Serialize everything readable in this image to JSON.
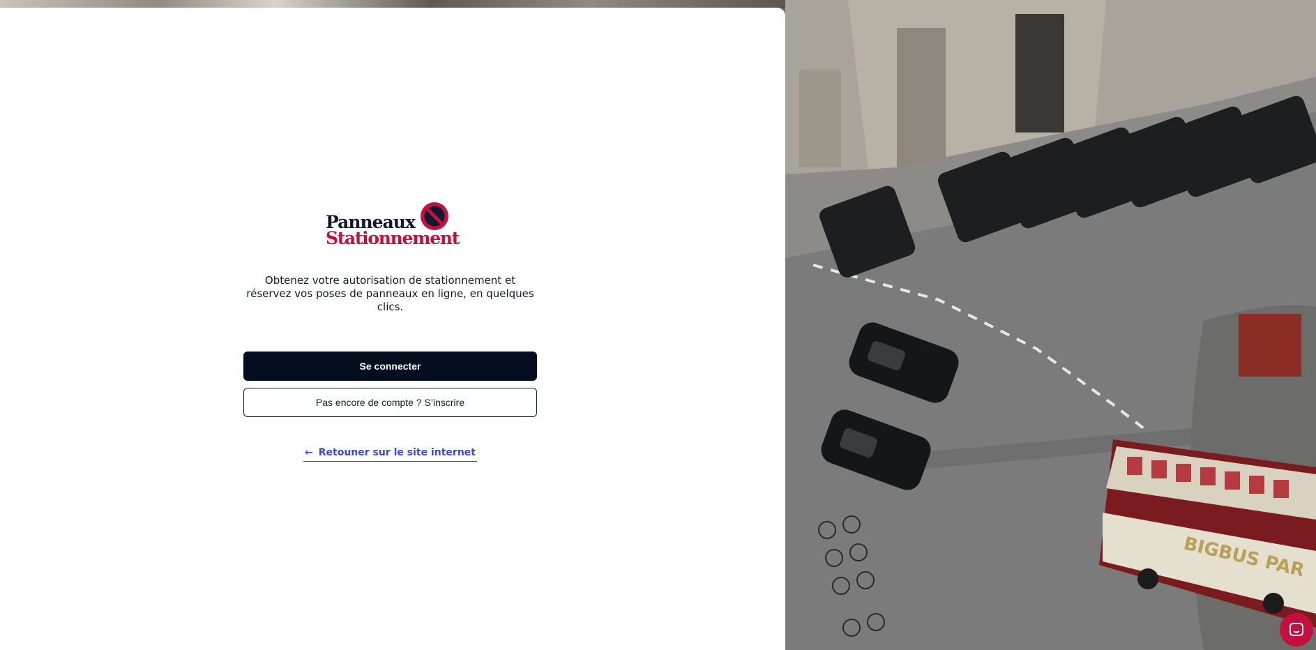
{
  "brand": {
    "line1": "Panneaux",
    "line2": "Stationnement",
    "colors": {
      "navy": "#0f1a30",
      "red": "#c5103d"
    }
  },
  "tagline": "Obtenez votre autorisation de stationnement et réservez vos poses de panneaux en ligne, en quelques clics.",
  "buttons": {
    "login": "Se connecter",
    "signup": "Pas encore de compte ? S’inscrire"
  },
  "back_link": {
    "icon": "arrow-left-icon",
    "label": "Retouner sur le site internet"
  },
  "photo_sign_text": "BIGBUS PAR",
  "chat": {
    "icon": "chat-icon",
    "color": "#c5103d"
  },
  "colors": {
    "primary": "#050e20",
    "link": "#3a49c9"
  }
}
